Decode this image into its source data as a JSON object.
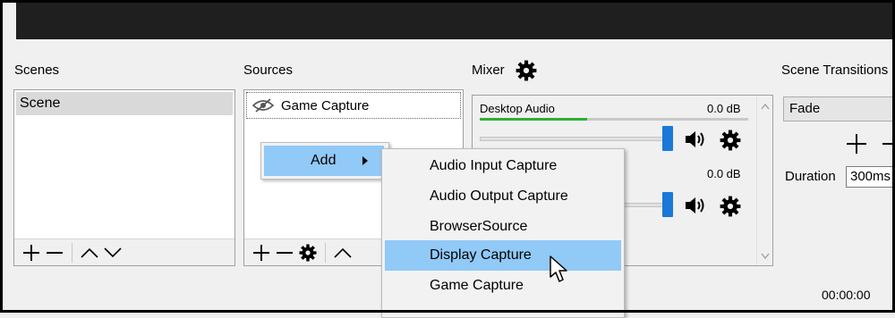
{
  "scenes": {
    "title": "Scenes",
    "items": [
      "Scene"
    ]
  },
  "sources": {
    "title": "Sources",
    "items": [
      {
        "label": "Game Capture",
        "icon": "eye-hidden-icon"
      }
    ]
  },
  "mixer": {
    "title": "Mixer",
    "channels": [
      {
        "name": "Desktop Audio",
        "db": "0.0 dB",
        "level": 0.33
      },
      {
        "name": "",
        "db": "0.0 dB",
        "level": 0
      }
    ]
  },
  "transitions": {
    "title": "Scene Transitions",
    "selected": "Fade",
    "duration_label": "Duration",
    "duration_value": "300ms"
  },
  "status": {
    "time": "00:00:00"
  },
  "context_menu": {
    "add_label": "Add"
  },
  "add_submenu": {
    "items": [
      "Audio Input Capture",
      "Audio Output Capture",
      "BrowserSource",
      "Display Capture",
      "Game Capture"
    ],
    "highlighted": "Display Capture"
  },
  "colors": {
    "highlight": "#91c9f7",
    "slider": "#1979d6",
    "meter_green": "#2db035"
  }
}
